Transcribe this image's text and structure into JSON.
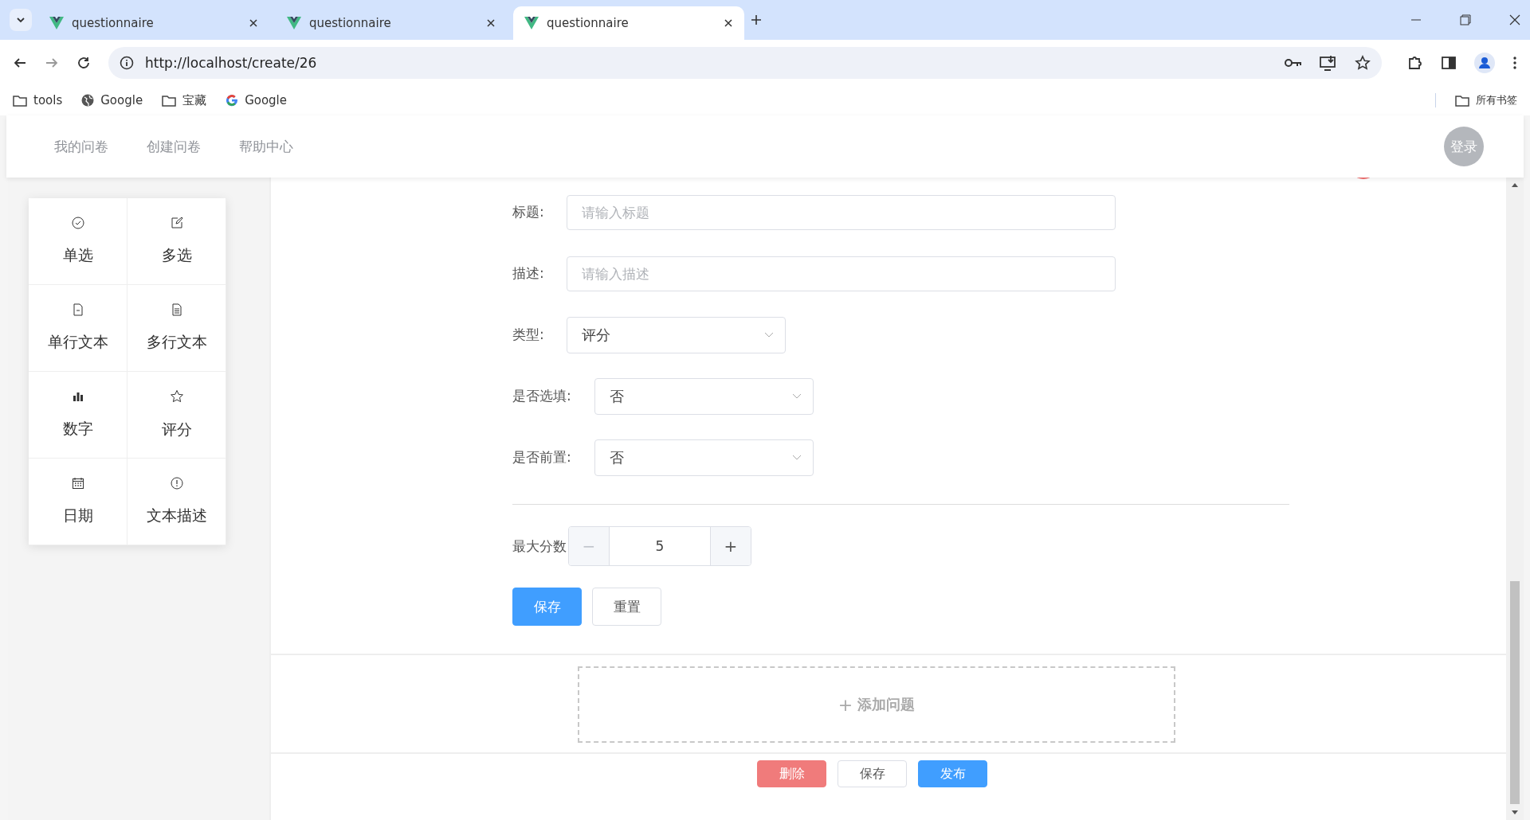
{
  "browser": {
    "tabs": [
      {
        "title": "questionnaire",
        "selected": false
      },
      {
        "title": "questionnaire",
        "selected": false
      },
      {
        "title": "questionnaire",
        "selected": true
      }
    ],
    "url": "http://localhost/create/26",
    "bookmarks": [
      {
        "kind": "folder",
        "label": "tools"
      },
      {
        "kind": "globe",
        "label": "Google"
      },
      {
        "kind": "folder",
        "label": "宝藏"
      },
      {
        "kind": "google",
        "label": "Google"
      }
    ],
    "all_bookmarks": "所有书签"
  },
  "nav": {
    "items": [
      "我的问卷",
      "创建问卷",
      "帮助中心"
    ],
    "login": "登录"
  },
  "palette": [
    {
      "kind": "radio",
      "label": "单选"
    },
    {
      "kind": "edit",
      "label": "多选"
    },
    {
      "kind": "doc",
      "label": "单行文本"
    },
    {
      "kind": "doclines",
      "label": "多行文本"
    },
    {
      "kind": "bars",
      "label": "数字"
    },
    {
      "kind": "star",
      "label": "评分"
    },
    {
      "kind": "calendar",
      "label": "日期"
    },
    {
      "kind": "info",
      "label": "文本描述"
    }
  ],
  "form": {
    "title": {
      "label": "标题:",
      "placeholder": "请输入标题"
    },
    "description": {
      "label": "描述:",
      "placeholder": "请输入描述"
    },
    "type": {
      "label": "类型:",
      "value": "评分"
    },
    "required": {
      "label": "是否选填:",
      "value": "否"
    },
    "prefix": {
      "label": "是否前置:",
      "value": "否"
    },
    "max_score": {
      "label": "最大分数",
      "minus": "−",
      "value": "5",
      "plus": "+"
    },
    "buttons": [
      {
        "kind": "primary",
        "label": "保存"
      },
      {
        "kind": "default",
        "label": "重置"
      }
    ]
  },
  "add_question": {
    "icon": "+",
    "label": "添加问题"
  },
  "footer_buttons": [
    {
      "kind": "danger",
      "label": "删除"
    },
    {
      "kind": "default",
      "label": "保存"
    },
    {
      "kind": "primary",
      "label": "发布"
    }
  ]
}
